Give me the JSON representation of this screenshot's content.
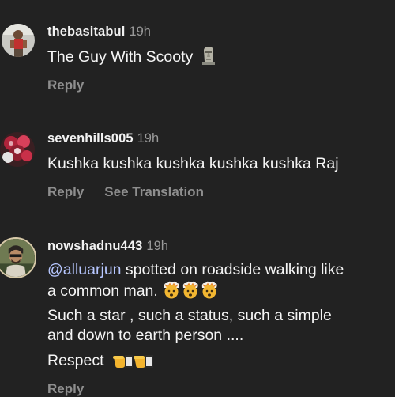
{
  "comments": [
    {
      "username": "thebasitabul",
      "time": "19h",
      "text": "The Guy With Scooty",
      "emoji": "moai-icon",
      "reply_label": "Reply"
    },
    {
      "username": "sevenhills005",
      "time": "19h",
      "text": "Kushka kushka kushka kushka kushka Raj",
      "reply_label": "Reply",
      "translate_label": "See Translation"
    },
    {
      "username": "nowshadnu443",
      "time": "19h",
      "mention": "@alluarjun",
      "line1_rest": " spotted on roadside walking like",
      "line2": "a common man.",
      "line2_emojis": [
        "exploding-head-icon",
        "exploding-head-icon",
        "exploding-head-icon"
      ],
      "line3": "Such a star , such a status, such a simple",
      "line4": "and down to earth person ....",
      "line5": "Respect",
      "line5_emojis": [
        "pointing-hand-icon",
        "pointing-hand-icon"
      ],
      "reply_label": "Reply"
    }
  ],
  "colors": {
    "background": "#222222",
    "text": "#f5f5f5",
    "muted": "#8e8e8e",
    "mention": "#b7c7ff"
  }
}
